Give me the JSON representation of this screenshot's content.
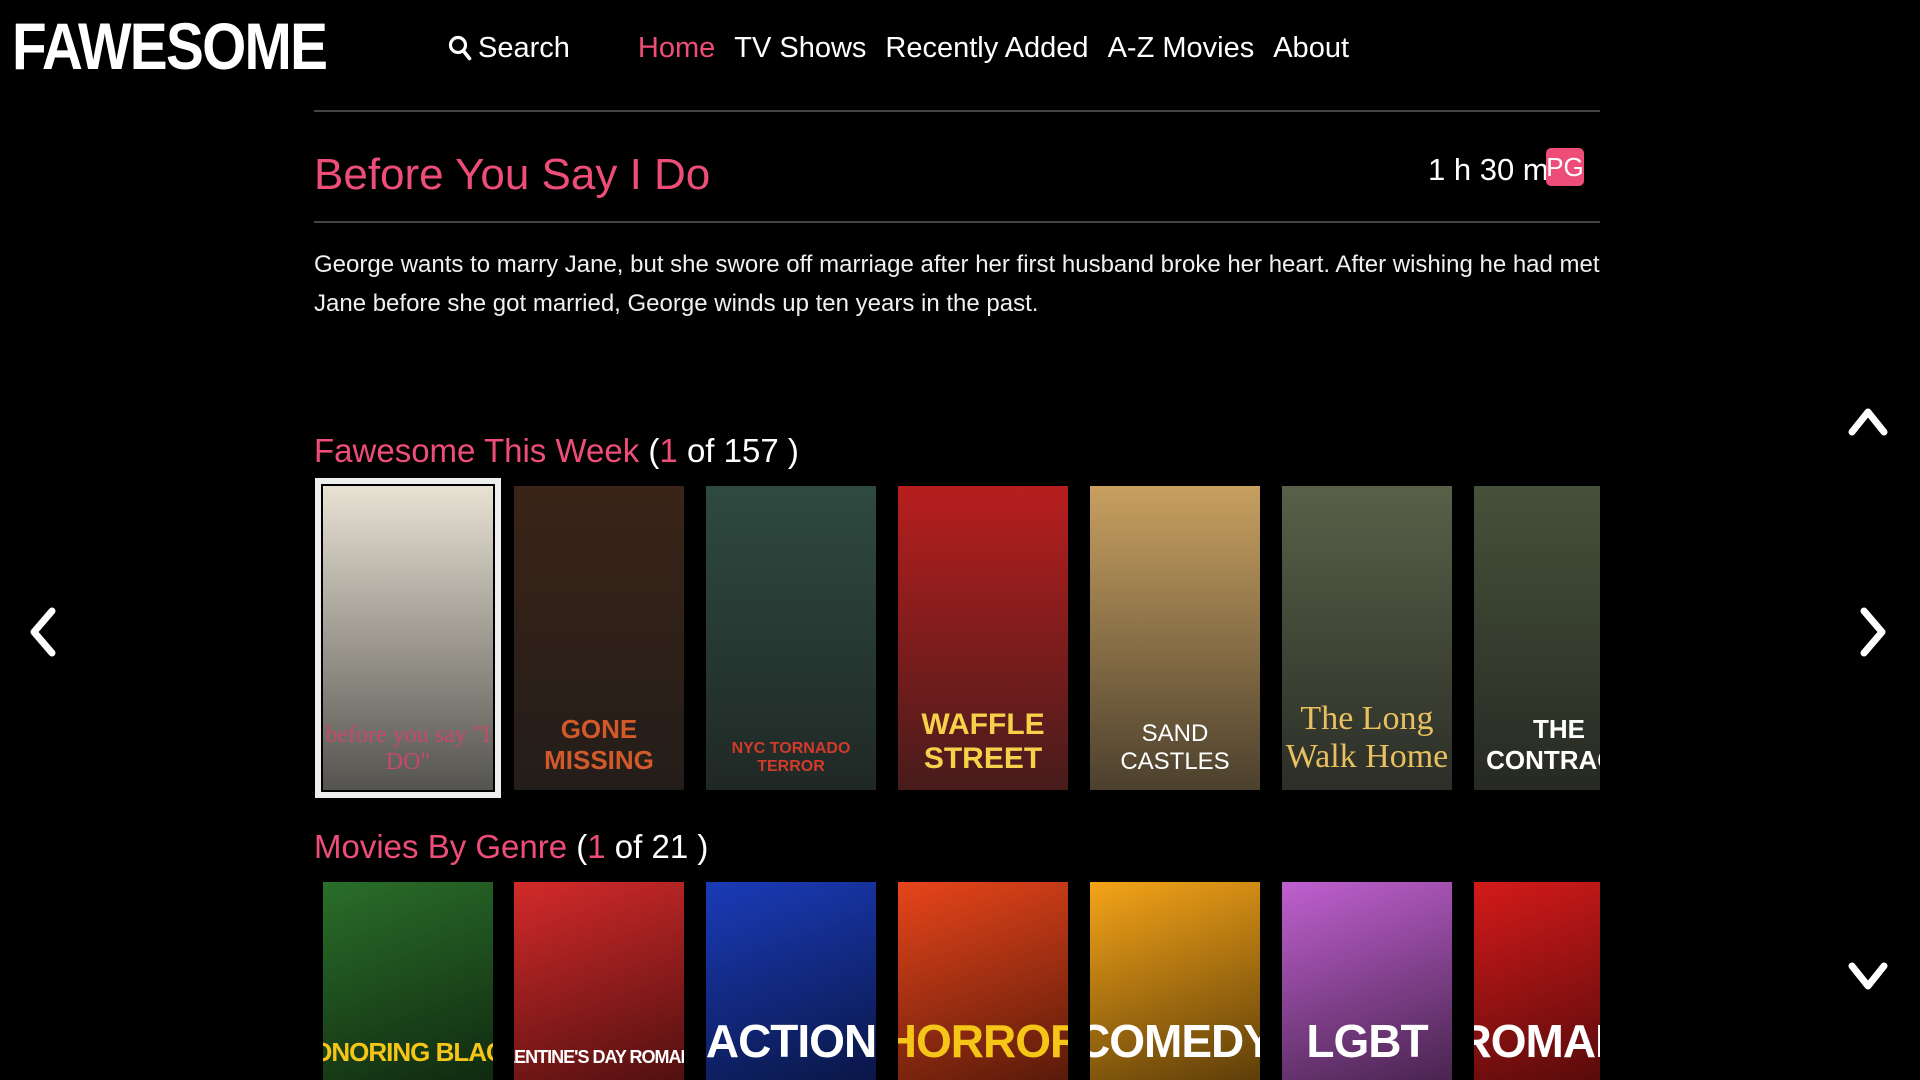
{
  "brand": {
    "logo": "FAWESOME",
    "accent": "#ee4d78"
  },
  "nav": {
    "search_label": "Search",
    "links": [
      "Home",
      "TV Shows",
      "Recently Added",
      "A-Z Movies",
      "About"
    ],
    "active": "Home"
  },
  "movie": {
    "title": "Before You Say I Do",
    "duration": "1 h 30 m",
    "rating": "PG",
    "description": "George wants to marry Jane, but she swore off marriage after her first husband broke her heart. After wishing he had met Jane before she got married, George winds up ten years in the past."
  },
  "sections": {
    "this_week": {
      "title": "Fawesome This Week",
      "open": "(",
      "current": "1",
      "of_total": "of 157",
      "close": ")"
    },
    "genres": {
      "title": "Movies By Genre",
      "open": "(",
      "current": "1",
      "of_total": "of 21",
      "close": ")"
    }
  },
  "posters": [
    {
      "title": "before you say \"I DO\"",
      "bg": "#e8e2d4",
      "color": "#c8486a"
    },
    {
      "title": "GONE MISSING",
      "bg": "#3a2418",
      "color": "#d25a2a"
    },
    {
      "title": "NYC TORNADO TERROR",
      "bg": "#2e4a40",
      "color": "#d23b2b"
    },
    {
      "title": "WAFFLE STREET",
      "bg": "#b81e1e",
      "color": "#f7d14a"
    },
    {
      "title": "SAND CASTLES",
      "bg": "#c8a060",
      "color": "#ffffff"
    },
    {
      "title": "The Long Walk Home",
      "bg": "#586048",
      "color": "#e8c060"
    },
    {
      "title": "THE CONTRACT",
      "bg": "#46513a",
      "color": "#ffffff"
    }
  ],
  "genres": [
    {
      "label": "HONORING BLACK",
      "bg": "#2a6e2a",
      "color": "#f5c518"
    },
    {
      "label": "VALENTINE'S DAY ROMANCE",
      "bg": "#d42a2a",
      "color": "#ffffff"
    },
    {
      "label": "ACTION",
      "bg": "#1a3bb8",
      "color": "#ffffff"
    },
    {
      "label": "HORROR",
      "bg": "#e8451a",
      "color": "#f5c518"
    },
    {
      "label": "COMEDY",
      "bg": "#f5a418",
      "color": "#ffffff"
    },
    {
      "label": "LGBT",
      "bg": "#c060d0",
      "color": "#ffffff"
    },
    {
      "label": "ROMANC",
      "bg": "#d41a1a",
      "color": "#ffffff"
    }
  ]
}
